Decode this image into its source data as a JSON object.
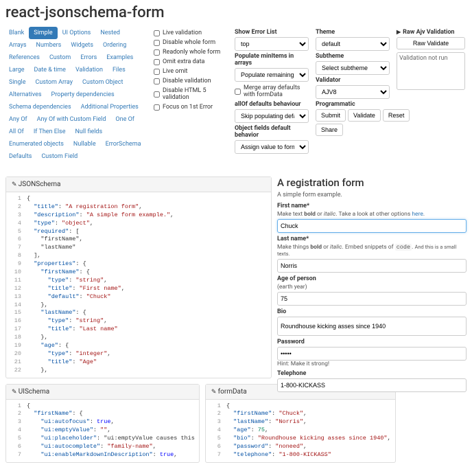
{
  "title": "react-jsonschema-form",
  "nav": {
    "items": [
      "Blank",
      "Simple",
      "UI Options",
      "Nested",
      "Arrays",
      "Numbers",
      "Widgets",
      "Ordering",
      "References",
      "Custom",
      "Errors",
      "Examples",
      "Large",
      "Date & time",
      "Validation",
      "Files",
      "Single",
      "Custom Array",
      "Custom Object",
      "Alternatives",
      "Property dependencies",
      "Schema dependencies",
      "Additional Properties",
      "Any Of",
      "Any Of with Custom Field",
      "One Of",
      "All Of",
      "If Then Else",
      "Null fields",
      "Enumerated objects",
      "Nullable",
      "ErrorSchema",
      "Defaults",
      "Custom Field"
    ],
    "active": "Simple"
  },
  "checks": [
    "Live validation",
    "Disable whole form",
    "Readonly whole form",
    "Omit extra data",
    "Live omit",
    "Disable validation",
    "Disable HTML 5 validation",
    "Focus on 1st Error"
  ],
  "options": {
    "errorList": {
      "label": "Show Error List",
      "value": "top"
    },
    "minItems": {
      "label": "Populate minItems in arrays",
      "value": "Populate remaining minItems"
    },
    "mergeDefaults": "Merge array defaults with formData",
    "allOf": {
      "label": "allOf defaults behaviour",
      "value": "Skip populating defaults with"
    },
    "objFields": {
      "label": "Object fields default behavior",
      "value": "Assign value to formData wh"
    },
    "theme": {
      "label": "Theme",
      "value": "default"
    },
    "subtheme": {
      "label": "Subtheme",
      "value": "Select subtheme"
    },
    "validator": {
      "label": "Validator",
      "value": "AJV8"
    },
    "programmatic": {
      "label": "Programmatic",
      "submit": "Submit",
      "validate": "Validate",
      "reset": "Reset",
      "share": "Share"
    },
    "raw": {
      "label": "Raw Ajv Validation",
      "button": "Raw Validate",
      "result": "Validation not run"
    }
  },
  "panels": {
    "json": "JSONSchema",
    "ui": "UISchema",
    "fd": "formData"
  },
  "jsonSchema": [
    "{",
    "  \"title\": \"A registration form\",",
    "  \"description\": \"A simple form example.\",",
    "  \"type\": \"object\",",
    "  \"required\": [",
    "    \"firstName\",",
    "    \"lastName\"",
    "  ],",
    "  \"properties\": {",
    "    \"firstName\": {",
    "      \"type\": \"string\",",
    "      \"title\": \"First name\",",
    "      \"default\": \"Chuck\"",
    "    },",
    "    \"lastName\": {",
    "      \"type\": \"string\",",
    "      \"title\": \"Last name\"",
    "    },",
    "    \"age\": {",
    "      \"type\": \"integer\",",
    "      \"title\": \"Age\"",
    "    },"
  ],
  "uiSchema": [
    "{",
    "  \"firstName\": {",
    "    \"ui:autofocus\": true,",
    "    \"ui:emptyValue\": \"\",",
    "    \"ui:placeholder\": \"ui:emptyValue causes this",
    "    \"ui:autocomplete\": \"family-name\",",
    "    \"ui:enableMarkdownInDescription\": true,"
  ],
  "formData": [
    "{",
    "  \"firstName\": \"Chuck\",",
    "  \"lastName\": \"Norris\",",
    "  \"age\": 75,",
    "  \"bio\": \"Roundhouse kicking asses since 1940\",",
    "  \"password\": \"noneed\",",
    "  \"telephone\": \"1-800-KICKASS\""
  ],
  "form": {
    "title": "A registration form",
    "desc": "A simple form example.",
    "firstName": {
      "label": "First name",
      "help": "Make text <b>bold</b> or <i>italic</i>. Take a look at other options <a>here</a>.",
      "value": "Chuck"
    },
    "lastName": {
      "label": "Last name",
      "help": "Make things <b>bold</b> or <i>italic</i>. Embed snippets of <code>code</code>. <small>And this is a small texts.</small>",
      "value": "Norris"
    },
    "age": {
      "label": "Age of person",
      "help": "(earth year)",
      "value": "75"
    },
    "bio": {
      "label": "Bio",
      "value": "Roundhouse kicking asses since 1940"
    },
    "password": {
      "label": "Password",
      "value": "•••••",
      "help": "Hint: Make it strong!"
    },
    "telephone": {
      "label": "Telephone",
      "value": "1-800-KICKASS"
    }
  }
}
